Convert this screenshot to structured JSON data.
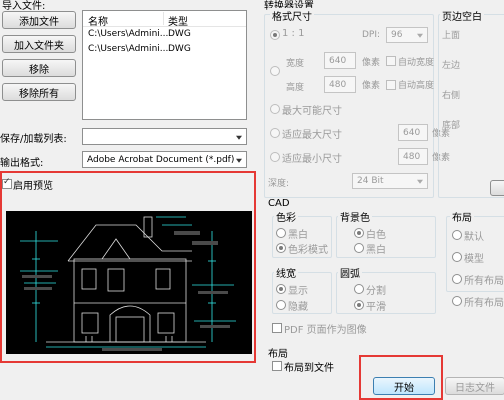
{
  "left": {
    "import_label": "导入文件:",
    "buttons": {
      "add_file": "添加文件",
      "add_folder": "加入文件夹",
      "remove": "移除",
      "remove_all": "移除所有"
    },
    "file_table": {
      "headers": [
        "名称",
        "类型"
      ],
      "rows": [
        {
          "name": "C:\\Users\\Admini...",
          "type": "DWG"
        },
        {
          "name": "C:\\Users\\Admini...",
          "type": "DWG"
        }
      ]
    },
    "save_load_label": "保存/加载列表:",
    "save_load_value": "",
    "output_format_label": "输出格式:",
    "output_format_value": "Adobe Acrobat Document (*.pdf)",
    "preview_label": "启用预览"
  },
  "settings": {
    "title": "转换器设置",
    "format_size": {
      "title": "格式尺寸",
      "ratio_label": "1 : 1",
      "dpi_label": "DPI:",
      "dpi_value": "96",
      "width_label": "宽度",
      "width_value": "640",
      "height_label": "高度",
      "height_value": "480",
      "unit": "像素",
      "auto_width": "自动宽度",
      "auto_height": "自动高度",
      "max_size": "最大可能尺寸",
      "fit_max": "适应最大尺寸",
      "fit_max_value": "640",
      "fit_min": "适应最小尺寸",
      "fit_min_value": "480",
      "depth_label": "深度:",
      "depth_value": "24 Bit"
    },
    "page_margin": {
      "title": "页边空白",
      "top": "上面",
      "left": "左边",
      "right": "右侧",
      "bottom": "底部"
    }
  },
  "cad": {
    "title": "CAD",
    "color": {
      "title": "色彩",
      "bw": "黑白",
      "color_mode": "色彩模式"
    },
    "background": {
      "title": "背景色",
      "white": "白色",
      "black": "黑白"
    },
    "layout": {
      "title": "布局",
      "default": "默认",
      "model": "模型",
      "all_layouts": "所有布局",
      "all_layouts2": "所有布局"
    },
    "lineweight": {
      "title": "线宽",
      "show": "显示",
      "hide": "隐藏"
    },
    "arc": {
      "title": "圆弧",
      "split": "分割",
      "smooth": "平滑"
    },
    "pdf_as_image": "PDF 页面作为图像"
  },
  "layout_section": {
    "title": "布局",
    "layout_to_file": "布局到文件"
  },
  "actions": {
    "start": "开始",
    "log": "日志文件"
  },
  "colors": {
    "highlight": "#e53935",
    "preview_bg": "#000000",
    "line": "#dcdcdc",
    "cyan": "#32e6e6"
  }
}
